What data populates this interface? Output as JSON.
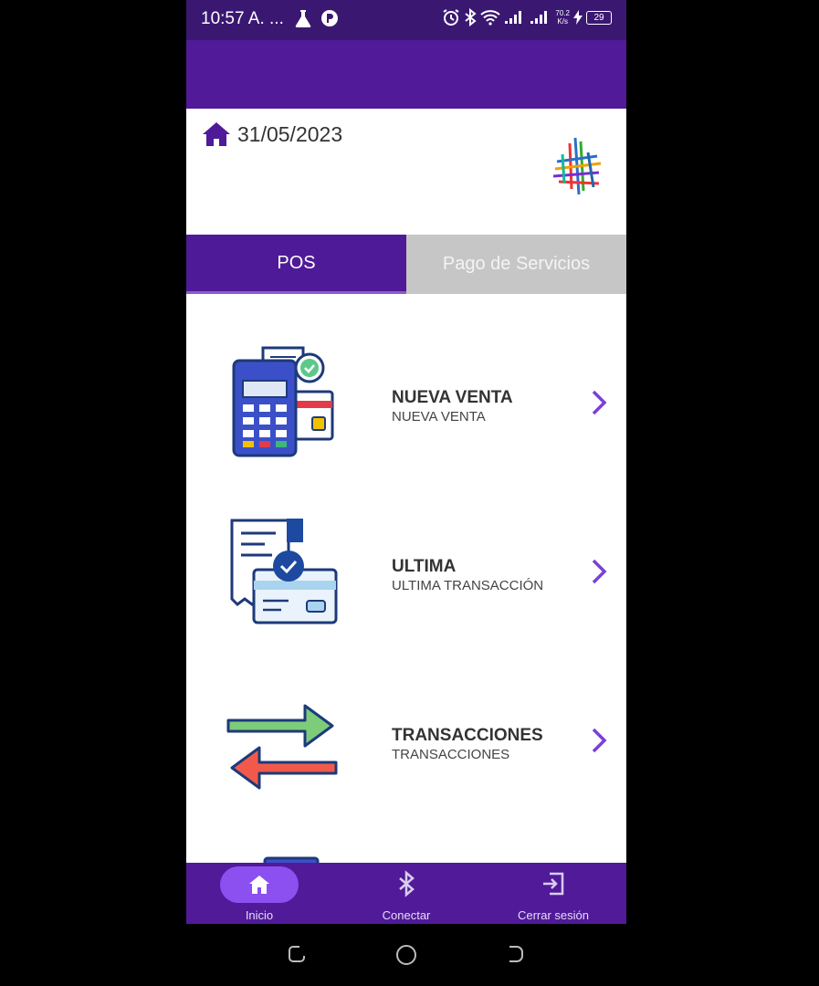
{
  "status_bar": {
    "time": "10:57 A. ...",
    "speed_value": "70.2",
    "speed_unit": "K/s",
    "battery": "29"
  },
  "header": {
    "date": "31/05/2023"
  },
  "tabs": [
    {
      "label": "POS",
      "active": true
    },
    {
      "label": "Pago de Servicios",
      "active": false
    }
  ],
  "menu": [
    {
      "title": "NUEVA VENTA",
      "subtitle": "NUEVA VENTA",
      "icon": "pos-terminal-icon"
    },
    {
      "title": "ULTIMA",
      "subtitle": "ULTIMA TRANSACCIÓN",
      "icon": "receipt-card-icon"
    },
    {
      "title": "TRANSACCIONES",
      "subtitle": "TRANSACCIONES",
      "icon": "transfer-arrows-icon"
    }
  ],
  "bottom_nav": [
    {
      "label": "Inicio",
      "icon": "home-icon",
      "active": true
    },
    {
      "label": "Conectar",
      "icon": "bluetooth-icon",
      "active": false
    },
    {
      "label": "Cerrar sesión",
      "icon": "logout-icon",
      "active": false
    }
  ],
  "colors": {
    "primary": "#501a99",
    "status_bar": "#3a1872",
    "accent": "#8c4ff0",
    "tab_inactive": "#c6c6c6",
    "chevron": "#7b3fd6"
  }
}
